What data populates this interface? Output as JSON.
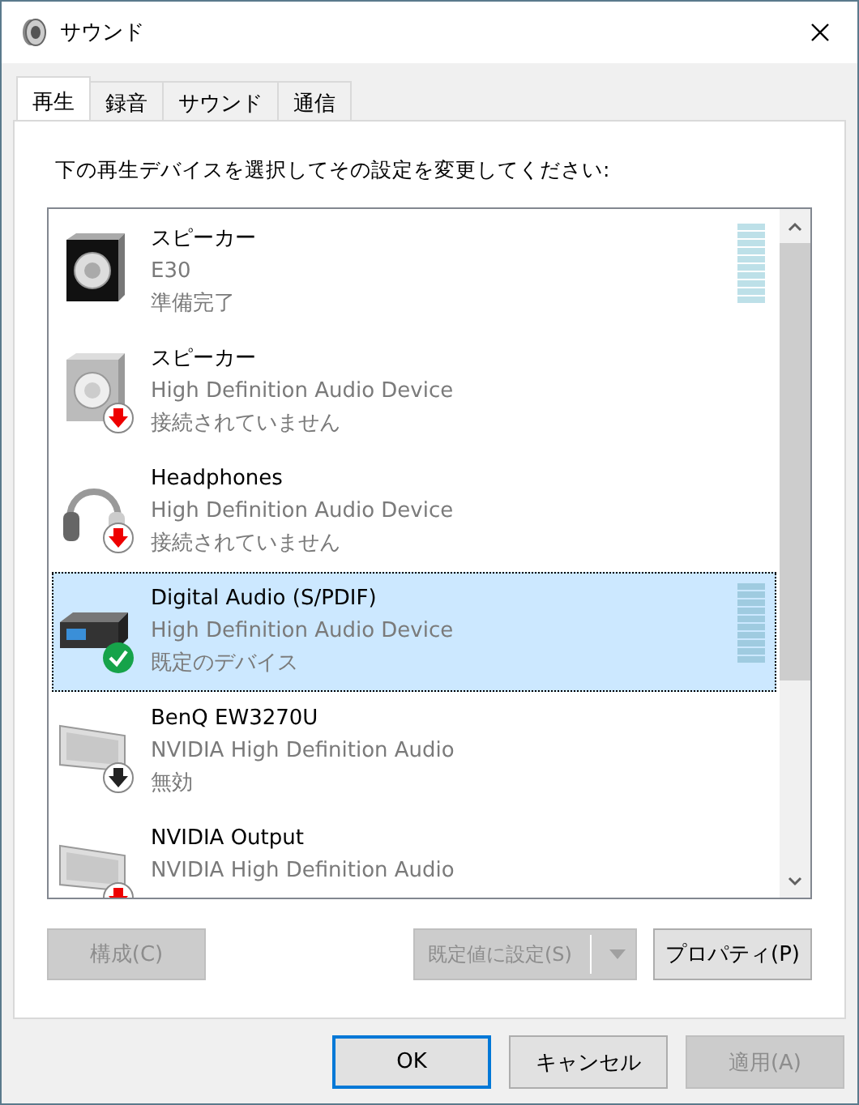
{
  "window": {
    "title": "サウンド"
  },
  "tabs": [
    {
      "label": "再生",
      "selected": true
    },
    {
      "label": "録音",
      "selected": false
    },
    {
      "label": "サウンド",
      "selected": false
    },
    {
      "label": "通信",
      "selected": false
    }
  ],
  "instruction": "下の再生デバイスを選択してその設定を変更してください:",
  "devices": [
    {
      "kind": "speaker",
      "name": "スピーカー",
      "description": "E30",
      "status": "準備完了",
      "selected": false,
      "level": 0
    },
    {
      "kind": "speaker",
      "badge": {
        "kind": "unplugged"
      },
      "name": "スピーカー",
      "description": "High Definition Audio Device",
      "status": "接続されていません",
      "selected": false
    },
    {
      "kind": "headphones",
      "badge": {
        "kind": "unplugged"
      },
      "name": "Headphones",
      "description": "High Definition Audio Device",
      "status": "接続されていません",
      "selected": false
    },
    {
      "kind": "receiver",
      "badge": {
        "kind": "default"
      },
      "name": "Digital Audio (S/PDIF)",
      "description": "High Definition Audio Device",
      "status": "既定のデバイス",
      "selected": true,
      "level": 0
    },
    {
      "kind": "monitor",
      "badge": {
        "kind": "disabled"
      },
      "name": "BenQ EW3270U",
      "description": "NVIDIA High Definition Audio",
      "status": "無効",
      "selected": false
    },
    {
      "kind": "monitor",
      "badge": {
        "kind": "unplugged"
      },
      "name": "NVIDIA Output",
      "description": "NVIDIA High Definition Audio",
      "selected": false
    }
  ],
  "panel_buttons": [
    {
      "label": "構成(C)",
      "disabled": true,
      "kind": "plain"
    },
    {
      "label": "既定値に設定(S)",
      "disabled": true,
      "kind": "split"
    },
    {
      "label": "プロパティ(P)",
      "disabled": false,
      "kind": "plain"
    }
  ],
  "dialog_buttons": [
    {
      "label": "OK",
      "disabled": false,
      "default": true
    },
    {
      "label": "キャンセル",
      "disabled": false,
      "default": false
    },
    {
      "label": "適用(A)",
      "disabled": true,
      "default": false
    }
  ]
}
